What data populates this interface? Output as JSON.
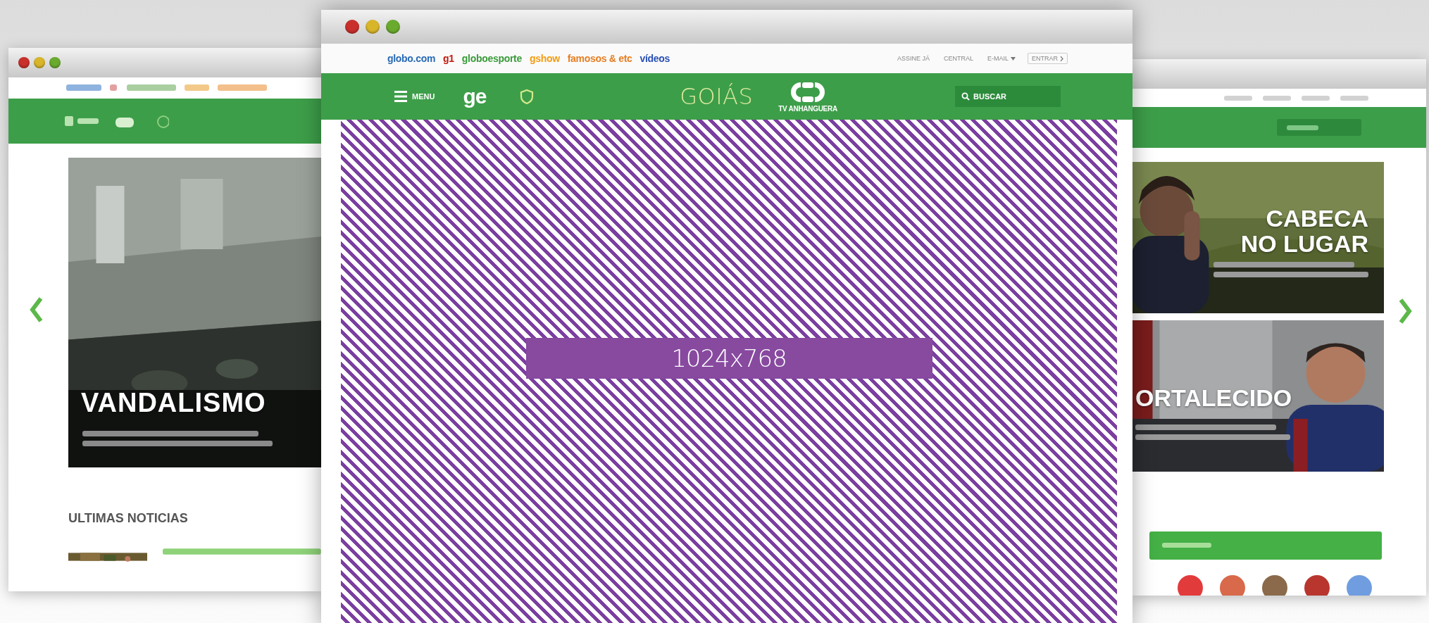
{
  "left_window": {
    "feature": {
      "kind": "picture",
      "headline": "VANDALISMO"
    },
    "section_title": "ULTIMAS NOTICIAS"
  },
  "main_window": {
    "top_links": [
      {
        "label": "globo.com",
        "color": "#2a6bb5"
      },
      {
        "label": "g1",
        "color": "#c4170c"
      },
      {
        "label": "globoesporte",
        "color": "#3a9b3a"
      },
      {
        "label": "gshow",
        "color": "#f39c12"
      },
      {
        "label": "famosos & etc",
        "color": "#e67e22"
      },
      {
        "label": "vídeos",
        "color": "#2a4fb5"
      }
    ],
    "account_links": [
      {
        "label": "ASSINE JÁ",
        "kind": "link"
      },
      {
        "label": "CENTRAL",
        "kind": "link"
      },
      {
        "label": "E-MAIL",
        "kind": "dropdown"
      },
      {
        "label": "ENTRAR",
        "kind": "button"
      }
    ],
    "header": {
      "menu_label": "MENU",
      "section_logo": "ge",
      "title": "GOIÁS",
      "brand": "TV ANHANGUERA",
      "search_placeholder": "BUSCAR"
    },
    "placeholder": {
      "label": "1024x768"
    }
  },
  "right_window": {
    "features": [
      {
        "kind": "picture",
        "headline_lines": [
          "CABECA",
          "NO LUGAR"
        ]
      },
      {
        "kind": "picture",
        "headline_lines": [
          "ORTALECIDO"
        ]
      }
    ],
    "teams": [
      {
        "color": "#e23b3b"
      },
      {
        "color": "#d8694a"
      },
      {
        "color": "#8a6a4a"
      },
      {
        "color": "#b8362e"
      },
      {
        "color": "#6f9de0"
      }
    ]
  }
}
